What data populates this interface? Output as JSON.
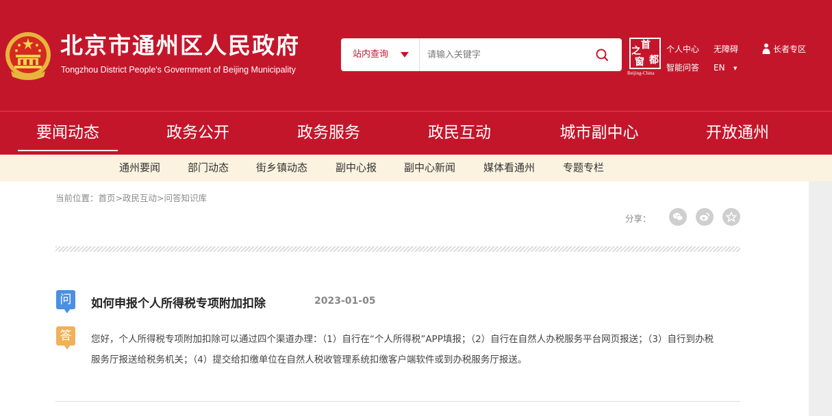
{
  "header": {
    "title": "北京市通州区人民政府",
    "subtitle": "Tongzhou District People's Government of Beijing Municipality",
    "search": {
      "scope_label": "站内查询",
      "placeholder": "请输入关键字"
    },
    "capital_logo": {
      "chars": [
        "首",
        "都",
        "之",
        "窗"
      ],
      "caption": "Beijing-China"
    },
    "links": {
      "personal_center": "个人中心",
      "accessibility": "无障碍",
      "smart_qa": "智能问答",
      "language": "EN",
      "elder_zone": "长者专区"
    }
  },
  "nav": {
    "active_index": 0,
    "items": [
      "要闻动态",
      "政务公开",
      "政务服务",
      "政民互动",
      "城市副中心",
      "开放通州"
    ]
  },
  "subnav": {
    "items": [
      "通州要闻",
      "部门动态",
      "街乡镇动态",
      "副中心报",
      "副中心新闻",
      "媒体看通州",
      "专题专栏"
    ]
  },
  "breadcrumb": {
    "label": "当前位置：",
    "items": [
      "首页",
      "政民互动",
      "问答知识库"
    ],
    "separator": ">"
  },
  "share": {
    "label": "分享：",
    "icons": [
      "wechat-icon",
      "weibo-icon",
      "favorite-star-icon"
    ]
  },
  "qa": {
    "question_badge": "问",
    "answer_badge": "答",
    "question": "如何申报个人所得税专项附加扣除",
    "date": "2023-01-05",
    "answer": "您好，个人所得税专项附加扣除可以通过四个渠道办理：（1）自行在“个人所得税”APP填报；（2）自行在自然人办税服务平台网页报送；（3）自行到办税服务厅报送给税务机关；（4）提交给扣缴单位在自然人税收管理系统扣缴客户端软件或到办税服务厅报送。"
  },
  "colors": {
    "brand_red": "#c4162b",
    "subnav_bg": "#fbf2df",
    "question_badge": "#4a90e2",
    "answer_badge": "#f0b15a"
  }
}
